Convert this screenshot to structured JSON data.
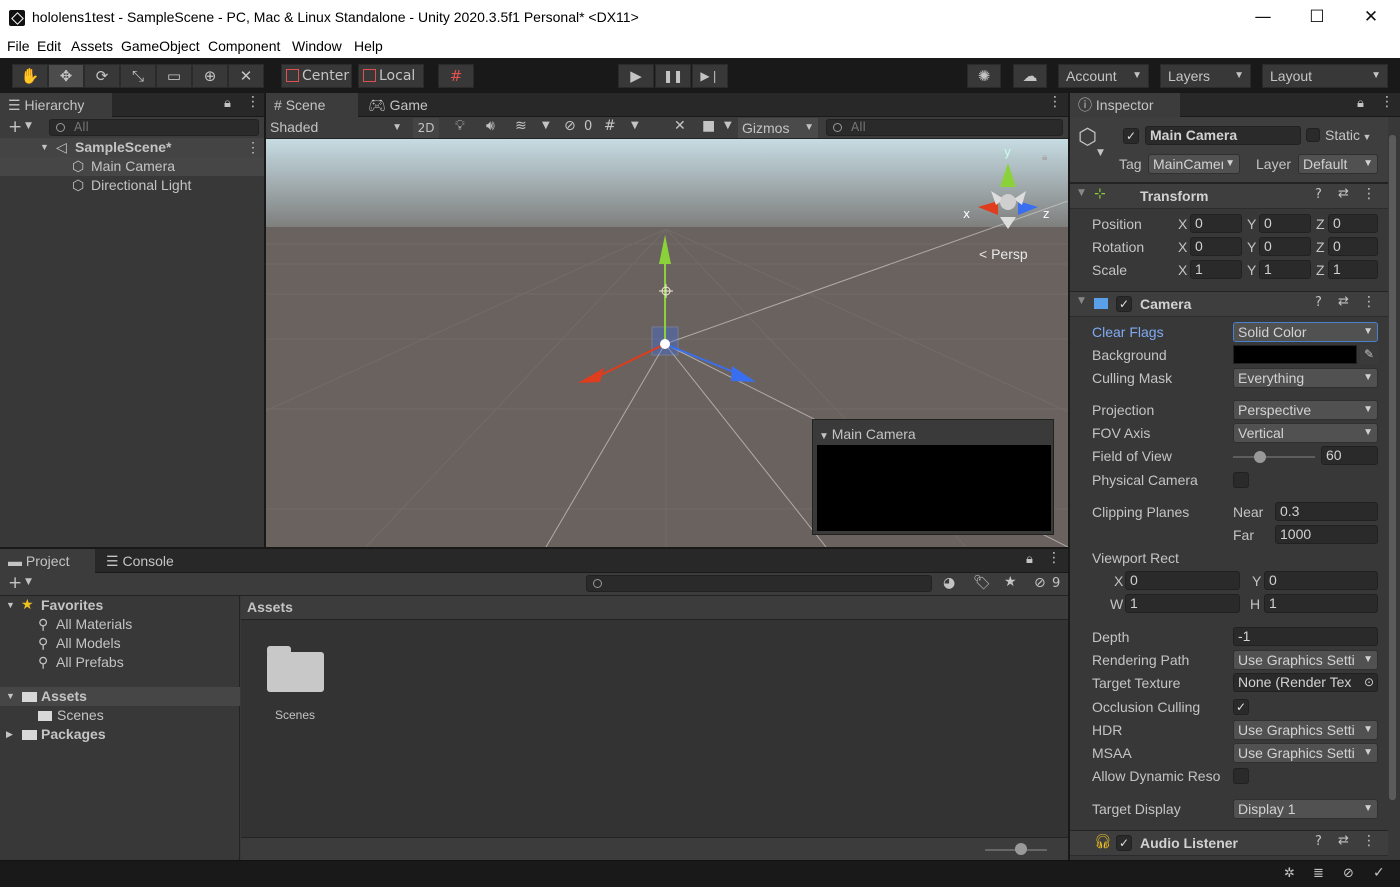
{
  "window": {
    "title": "hololens1test - SampleScene - PC, Mac & Linux Standalone - Unity 2020.3.5f1 Personal* <DX11>",
    "minimize": "—",
    "maximize": "☐",
    "close": "✕"
  },
  "menu": [
    "File",
    "Edit",
    "Assets",
    "GameObject",
    "Component",
    "Window",
    "Help"
  ],
  "toolbar": {
    "pivot": "Center",
    "space": "Local",
    "account": "Account",
    "layers": "Layers",
    "layout": "Layout"
  },
  "hierarchy": {
    "tab": "Hierarchy",
    "add": "+",
    "search_placeholder": "All",
    "scene": "SampleScene*",
    "items": [
      "Main Camera",
      "Directional Light"
    ]
  },
  "scene_view": {
    "tabs": [
      "Scene",
      "Game"
    ],
    "shading": "Shaded",
    "mode2d": "2D",
    "hidden_count": "0",
    "gizmos": "Gizmos",
    "search_placeholder": "All",
    "persp": "Persp",
    "axis_x": "x",
    "axis_y": "y",
    "axis_z": "z",
    "preview_title": "Main Camera"
  },
  "project": {
    "tabs": [
      "Project",
      "Console"
    ],
    "add": "+",
    "hidden_count": "9",
    "favorites_label": "Favorites",
    "favorites": [
      "All Materials",
      "All Models",
      "All Prefabs"
    ],
    "assets_label": "Assets",
    "asset_children": [
      "Scenes"
    ],
    "packages_label": "Packages",
    "breadcrumb": "Assets",
    "files": [
      "Scenes"
    ]
  },
  "inspector": {
    "tab": "Inspector",
    "object_name": "Main Camera",
    "static": "Static",
    "tag_label": "Tag",
    "tag": "MainCamera",
    "layer_label": "Layer",
    "layer": "Default",
    "transform": {
      "title": "Transform",
      "rows": [
        {
          "label": "Position",
          "x": "0",
          "y": "0",
          "z": "0"
        },
        {
          "label": "Rotation",
          "x": "0",
          "y": "0",
          "z": "0"
        },
        {
          "label": "Scale",
          "x": "1",
          "y": "1",
          "z": "1"
        }
      ]
    },
    "camera": {
      "title": "Camera",
      "clear_flags": {
        "label": "Clear Flags",
        "value": "Solid Color"
      },
      "background": {
        "label": "Background",
        "color": "#000000"
      },
      "culling_mask": {
        "label": "Culling Mask",
        "value": "Everything"
      },
      "projection": {
        "label": "Projection",
        "value": "Perspective"
      },
      "fov_axis": {
        "label": "FOV Axis",
        "value": "Vertical"
      },
      "fov": {
        "label": "Field of View",
        "value": "60",
        "fraction": 0.33
      },
      "physical": {
        "label": "Physical Camera"
      },
      "clipping": {
        "label": "Clipping Planes",
        "near_label": "Near",
        "near": "0.3",
        "far_label": "Far",
        "far": "1000"
      },
      "viewport": {
        "label": "Viewport Rect",
        "x_label": "X",
        "x": "0",
        "y_label": "Y",
        "y": "0",
        "w_label": "W",
        "w": "1",
        "h_label": "H",
        "h": "1"
      },
      "depth": {
        "label": "Depth",
        "value": "-1"
      },
      "rendering_path": {
        "label": "Rendering Path",
        "value": "Use Graphics Setti"
      },
      "target_texture": {
        "label": "Target Texture",
        "value": "None (Render Tex"
      },
      "occlusion": {
        "label": "Occlusion Culling"
      },
      "hdr": {
        "label": "HDR",
        "value": "Use Graphics Setti"
      },
      "msaa": {
        "label": "MSAA",
        "value": "Use Graphics Setti"
      },
      "dynamic_res": {
        "label": "Allow Dynamic Reso"
      },
      "target_display": {
        "label": "Target Display",
        "value": "Display 1"
      }
    },
    "audio_listener": {
      "title": "Audio Listener"
    }
  },
  "colors": {
    "accent_label": "#80aaf4",
    "bg": "#383838",
    "x_axis": "#e03c1e",
    "y_axis": "#8bd23a",
    "z_axis": "#3a6ef0"
  }
}
